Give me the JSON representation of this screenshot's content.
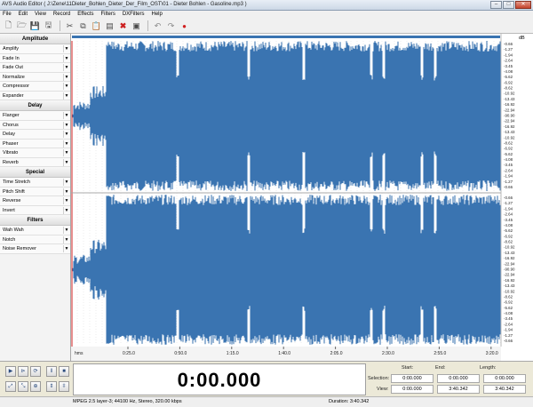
{
  "window": {
    "title": "AVS Audio Editor ( J:\\Zene\\11Dieter_Bohlen_Dieter_Der_Film_OST\\01 - Dieter Bohlen - Gasoline.mp3 )"
  },
  "menu": [
    "File",
    "Edit",
    "View",
    "Record",
    "Effects",
    "Filters",
    "DXFilters",
    "Help"
  ],
  "sidebar": {
    "groups": [
      {
        "title": "Amplitude",
        "items": [
          "Amplify",
          "Fade In",
          "Fade Out",
          "Normalize",
          "Compressor",
          "Expander"
        ]
      },
      {
        "title": "Delay",
        "items": [
          "Flanger",
          "Chorus",
          "Delay",
          "Phaser",
          "Vibrato",
          "Reverb"
        ]
      },
      {
        "title": "Special",
        "items": [
          "Time Stretch",
          "Pitch Shift",
          "Reverse",
          "Invert"
        ]
      },
      {
        "title": "Filters",
        "items": [
          "Wah Wah",
          "Notch",
          "Noise Remover"
        ]
      }
    ]
  },
  "waveform": {
    "color": "#3a74b1",
    "db_header": "dB",
    "db_ticks": [
      "-0.66",
      "-1.27",
      "-1.94",
      "-2.64",
      "-3.45",
      "-4.08",
      "-5.62",
      "-6.92",
      "-8.62",
      "-10.92",
      "-13.43",
      "-16.92",
      "-22.94",
      "-90.90",
      "-22.94",
      "-16.92",
      "-13.43",
      "-10.92",
      "-8.62",
      "-6.92",
      "-5.62",
      "-4.08",
      "-3.45",
      "-2.64",
      "-1.94",
      "-1.27",
      "-0.66"
    ],
    "time_labels": [
      "hms",
      "0:25.0",
      "0:50.0",
      "1:15.0",
      "1:40.0",
      "2:05.0",
      "2:30.0",
      "2:55.0",
      "3:20.0"
    ]
  },
  "transport": {
    "time": "0:00.000"
  },
  "info": {
    "headers": [
      "Start:",
      "End:",
      "Length:"
    ],
    "rows": [
      {
        "label": "Selection:",
        "values": [
          "0:00.000",
          "0:00.000",
          "0:00.000"
        ]
      },
      {
        "label": "View:",
        "values": [
          "0:00.000",
          "3:40.342",
          "3:40.342"
        ]
      }
    ]
  },
  "status": {
    "format": "MPEG 2.5 layer-3; 44100 Hz, Stereo, 320.00 kbps",
    "duration": "Duration: 3:40.342"
  }
}
